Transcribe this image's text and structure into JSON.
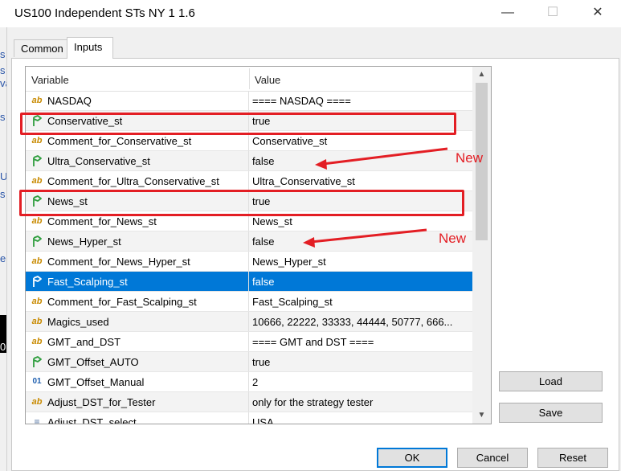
{
  "window": {
    "title": "US100 Independent STs NY 1 1.6",
    "minimize": "—",
    "maximize": "☐",
    "close": "✕"
  },
  "background_peek": [
    "s",
    "s",
    "va",
    "s",
    "U",
    "s",
    "e",
    "0"
  ],
  "tabs": [
    {
      "label": "Common",
      "active": false
    },
    {
      "label": "Inputs",
      "active": true
    }
  ],
  "grid": {
    "header": {
      "variable": "Variable",
      "value": "Value"
    },
    "rows": [
      {
        "icon": "ab",
        "name": "NASDAQ",
        "value": "==== NASDAQ ===="
      },
      {
        "icon": "bool",
        "name": "Conservative_st",
        "value": "true"
      },
      {
        "icon": "ab",
        "name": "Comment_for_Conservative_st",
        "value": "Conservative_st"
      },
      {
        "icon": "bool",
        "name": "Ultra_Conservative_st",
        "value": "false"
      },
      {
        "icon": "ab",
        "name": "Comment_for_Ultra_Conservative_st",
        "value": "Ultra_Conservative_st"
      },
      {
        "icon": "bool",
        "name": "News_st",
        "value": "true"
      },
      {
        "icon": "ab",
        "name": "Comment_for_News_st",
        "value": "News_st"
      },
      {
        "icon": "bool",
        "name": "News_Hyper_st",
        "value": "false"
      },
      {
        "icon": "ab",
        "name": "Comment_for_News_Hyper_st",
        "value": "News_Hyper_st"
      },
      {
        "icon": "bool",
        "name": "Fast_Scalping_st",
        "value": "false",
        "selected": true
      },
      {
        "icon": "ab",
        "name": "Comment_for_Fast_Scalping_st",
        "value": "Fast_Scalping_st"
      },
      {
        "icon": "ab",
        "name": "Magics_used",
        "value": "10666, 22222, 33333, 44444, 50777, 666..."
      },
      {
        "icon": "ab",
        "name": "GMT_and_DST",
        "value": "==== GMT and DST ===="
      },
      {
        "icon": "bool",
        "name": "GMT_Offset_AUTO",
        "value": "true"
      },
      {
        "icon": "num",
        "name": "GMT_Offset_Manual",
        "value": "2"
      },
      {
        "icon": "ab",
        "name": "Adjust_DST_for_Tester",
        "value": "only for the strategy tester"
      },
      {
        "icon": "list",
        "name": "Adjust_DST_select",
        "value": "USA"
      }
    ]
  },
  "annotations": {
    "new_label_1": "New",
    "new_label_2": "New",
    "color": "#e31e24"
  },
  "buttons": {
    "load": "Load",
    "save": "Save",
    "ok": "OK",
    "cancel": "Cancel",
    "reset": "Reset"
  },
  "colors": {
    "selection": "#0078d7",
    "bool_icon": "#2e9e3e",
    "string_icon": "#c88a00"
  }
}
